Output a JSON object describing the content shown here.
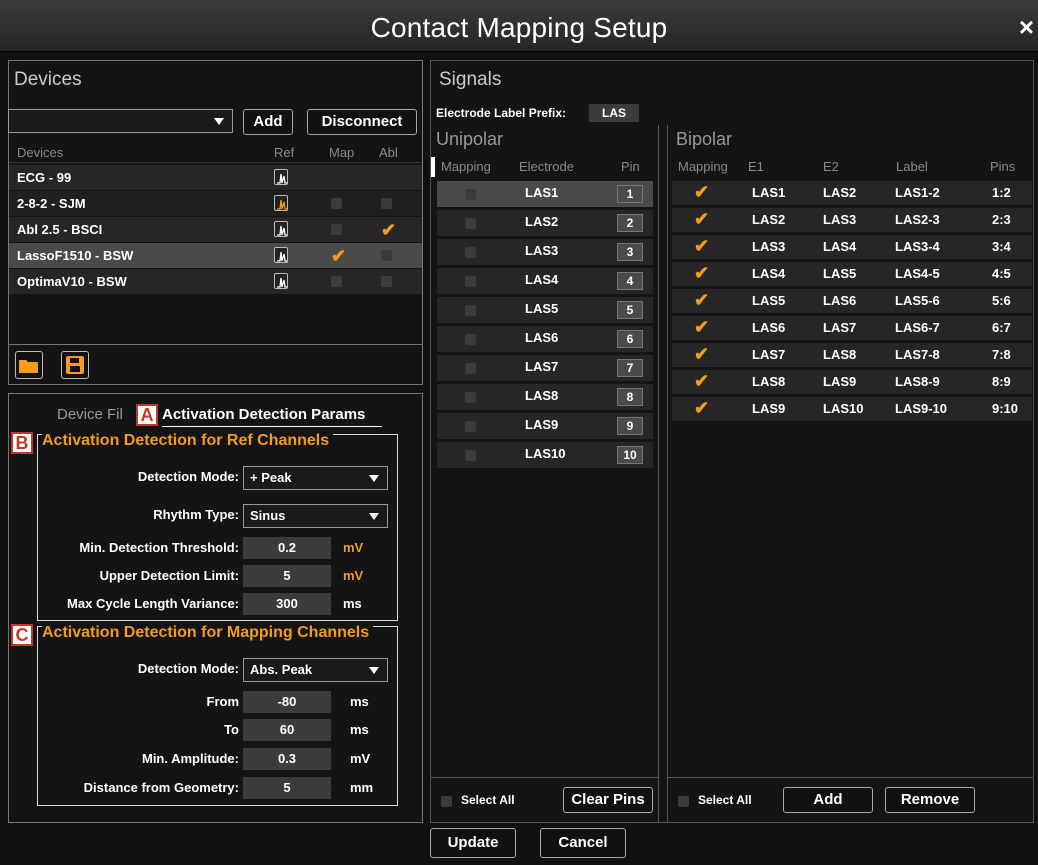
{
  "window": {
    "title": "Contact Mapping Setup",
    "close": "×"
  },
  "devices": {
    "title": "Devices",
    "add": "Add",
    "disconnect": "Disconnect",
    "dropdown_value": "",
    "headers": [
      "Devices",
      "Ref",
      "Map",
      "Abl"
    ],
    "rows": [
      {
        "name": "ECG - 99",
        "ref": true,
        "ref_active": false,
        "map": null,
        "abl": null,
        "selected": false
      },
      {
        "name": "2-8-2 - SJM",
        "ref": true,
        "ref_active": true,
        "map": false,
        "abl": false,
        "selected": false
      },
      {
        "name": "Abl 2.5 - BSCI",
        "ref": true,
        "ref_active": false,
        "map": false,
        "abl": true,
        "selected": false
      },
      {
        "name": "LassoF1510 - BSW",
        "ref": true,
        "ref_active": false,
        "map": true,
        "abl": false,
        "selected": true
      },
      {
        "name": "OptimaV10 - BSW",
        "ref": true,
        "ref_active": false,
        "map": false,
        "abl": false,
        "selected": false
      }
    ]
  },
  "tabs": {
    "tab1": "Device Fil",
    "tab2": "Activation Detection Params"
  },
  "badges": {
    "a": "A",
    "b": "B",
    "c": "C"
  },
  "ref_section": {
    "title": "Activation Detection for Ref Channels",
    "detection_mode_label": "Detection Mode:",
    "detection_mode": "+ Peak",
    "rhythm_label": "Rhythm Type:",
    "rhythm": "Sinus",
    "min_thr_label": "Min. Detection Threshold:",
    "min_thr": "0.2",
    "min_thr_unit": "mV",
    "upper_label": "Upper Detection Limit:",
    "upper": "5",
    "upper_unit": "mV",
    "cycle_label": "Max Cycle Length Variance:",
    "cycle": "300",
    "cycle_unit": "ms"
  },
  "map_section": {
    "title": "Activation Detection for Mapping Channels",
    "detection_mode_label": "Detection Mode:",
    "detection_mode": "Abs. Peak",
    "from_label": "From",
    "from": "-80",
    "from_unit": "ms",
    "to_label": "To",
    "to": "60",
    "to_unit": "ms",
    "amp_label": "Min. Amplitude:",
    "amp": "0.3",
    "amp_unit": "mV",
    "dist_label": "Distance from Geometry:",
    "dist": "5",
    "dist_unit": "mm"
  },
  "signals": {
    "title": "Signals",
    "prefix_label": "Electrode Label Prefix:",
    "prefix": "LAS",
    "unipolar": {
      "title": "Unipolar",
      "headers": [
        "Mapping",
        "Electrode",
        "Pin"
      ],
      "rows": [
        {
          "electrode": "LAS1",
          "pin": "1"
        },
        {
          "electrode": "LAS2",
          "pin": "2"
        },
        {
          "electrode": "LAS3",
          "pin": "3"
        },
        {
          "electrode": "LAS4",
          "pin": "4"
        },
        {
          "electrode": "LAS5",
          "pin": "5"
        },
        {
          "electrode": "LAS6",
          "pin": "6"
        },
        {
          "electrode": "LAS7",
          "pin": "7"
        },
        {
          "electrode": "LAS8",
          "pin": "8"
        },
        {
          "electrode": "LAS9",
          "pin": "9"
        },
        {
          "electrode": "LAS10",
          "pin": "10"
        }
      ],
      "select_all": "Select All",
      "clear_pins": "Clear Pins"
    },
    "bipolar": {
      "title": "Bipolar",
      "headers": [
        "Mapping",
        "E1",
        "E2",
        "Label",
        "Pins"
      ],
      "rows": [
        {
          "e1": "LAS1",
          "e2": "LAS2",
          "label": "LAS1-2",
          "pins": "1:2"
        },
        {
          "e1": "LAS2",
          "e2": "LAS3",
          "label": "LAS2-3",
          "pins": "2:3"
        },
        {
          "e1": "LAS3",
          "e2": "LAS4",
          "label": "LAS3-4",
          "pins": "3:4"
        },
        {
          "e1": "LAS4",
          "e2": "LAS5",
          "label": "LAS4-5",
          "pins": "4:5"
        },
        {
          "e1": "LAS5",
          "e2": "LAS6",
          "label": "LAS5-6",
          "pins": "5:6"
        },
        {
          "e1": "LAS6",
          "e2": "LAS7",
          "label": "LAS6-7",
          "pins": "6:7"
        },
        {
          "e1": "LAS7",
          "e2": "LAS8",
          "label": "LAS7-8",
          "pins": "7:8"
        },
        {
          "e1": "LAS8",
          "e2": "LAS9",
          "label": "LAS8-9",
          "pins": "8:9"
        },
        {
          "e1": "LAS9",
          "e2": "LAS10",
          "label": "LAS9-10",
          "pins": "9:10"
        }
      ],
      "select_all": "Select All",
      "add": "Add",
      "remove": "Remove"
    }
  },
  "footer": {
    "update": "Update",
    "cancel": "Cancel"
  },
  "colors": {
    "accent": "#f39c1f",
    "badge": "#c0392b"
  }
}
